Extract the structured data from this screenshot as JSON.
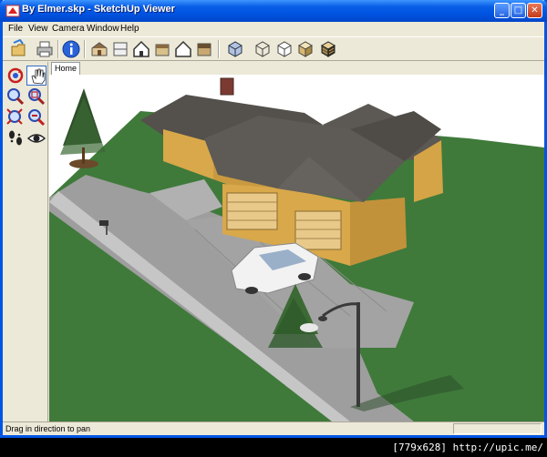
{
  "window": {
    "title": "By Elmer.skp - SketchUp Viewer",
    "minimize_glyph": "_",
    "maximize_glyph": "□",
    "close_glyph": "✕"
  },
  "menu": {
    "items": [
      "File",
      "View",
      "Camera",
      "Window",
      "Help"
    ]
  },
  "toolbar": {
    "icons": [
      "open-file-icon",
      "print-icon",
      "model-info-icon",
      "iso-view-icon",
      "top-view-icon",
      "front-view-icon",
      "right-view-icon",
      "back-view-icon",
      "left-view-icon",
      "xray-style-icon",
      "wireframe-style-icon",
      "hidden-line-style-icon",
      "shaded-style-icon",
      "shaded-texture-style-icon"
    ]
  },
  "sidebar": {
    "icons": [
      "orbit-icon",
      "pan-icon",
      "zoom-icon",
      "zoom-window-icon",
      "zoom-extents-icon",
      "previous-view-icon",
      "walk-icon",
      "look-around-icon"
    ],
    "active": "pan-icon"
  },
  "scene_tabs": {
    "items": [
      "Home"
    ]
  },
  "status": {
    "text": "Drag in direction to pan"
  },
  "watermark": {
    "text": "[779x628] http://upic.me/"
  },
  "colors": {
    "grass": "#3f7a3a",
    "concrete": "#a8a8a8",
    "roof": "#5a5550",
    "wall": "#d9a94a",
    "titlebar": "#0054e3"
  }
}
